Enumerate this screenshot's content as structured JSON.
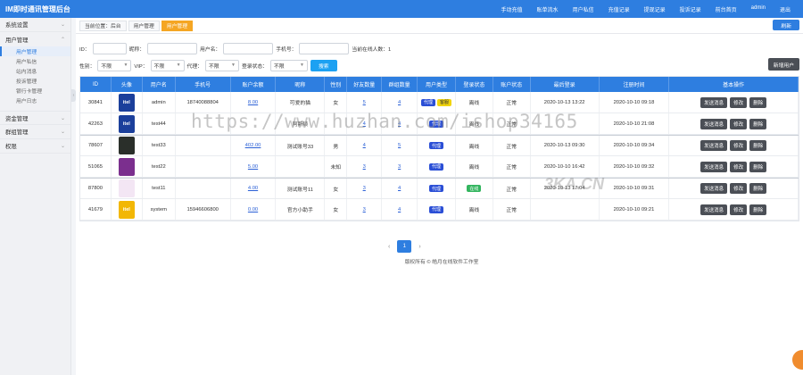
{
  "header": {
    "app_title": "IM即时通讯管理后台",
    "nav": [
      "手动充值",
      "账单流水",
      "用户私信",
      "充值记录",
      "提现记录",
      "投诉记录",
      "前台首页",
      "admin",
      "退出"
    ]
  },
  "sidebar": {
    "groups": [
      {
        "label": "系统设置",
        "items": []
      },
      {
        "label": "用户管理",
        "items": [
          "用户管理",
          "用户私信",
          "站内消息",
          "投诉管理",
          "银行卡管理",
          "用户日志"
        ]
      },
      {
        "label": "资金管理",
        "items": []
      },
      {
        "label": "群组管理",
        "items": []
      },
      {
        "label": "权限",
        "items": []
      }
    ],
    "active_item": "用户管理"
  },
  "tabs": {
    "crumbs": [
      "当前位置：后台",
      "用户管理",
      "用户管理"
    ],
    "refresh_label": "刷新"
  },
  "filters": {
    "id_label": "ID：",
    "nickname_label": "昵称：",
    "username_label": "用户名：",
    "phone_label": "手机号：",
    "online_stat_label": "当前在线人数：",
    "online_count": "1",
    "gender_label": "性别：",
    "gender_value": "不限",
    "vip_label": "VIP：",
    "vip_value": "不限",
    "agent_label": "代理：",
    "agent_value": "不限",
    "login_status_label": "登录状态：",
    "login_status_value": "不限",
    "search_label": "搜索",
    "add_user_label": "新增用户"
  },
  "table": {
    "columns": [
      "ID",
      "头像",
      "用户名",
      "手机号",
      "账户余额",
      "昵称",
      "性别",
      "好友数量",
      "群组数量",
      "用户类型",
      "登录状态",
      "账户状态",
      "最后登录",
      "注册时间",
      "基本操作"
    ],
    "rows": [
      {
        "id": "30841",
        "avatar": "itel",
        "avatar_color": "#1b3f9b",
        "username": "admin",
        "phone": "18740088804",
        "balance": "8.00",
        "nickname": "可爱的猫",
        "gender": "女",
        "friends": "5",
        "groups": "4",
        "types": [
          {
            "label": "代理",
            "color": "#2b4fd6"
          },
          {
            "label": "客服",
            "color": "#f1d40d"
          }
        ],
        "login_status": "离线",
        "account_status": "正常",
        "last_login": "2020-10-13 13:22",
        "reg_time": "2020-10-10 09:18"
      },
      {
        "id": "42263",
        "avatar": "itel",
        "avatar_color": "#1b3f9b",
        "username": "test44",
        "phone": "",
        "balance": "",
        "nickname": "阿斯顿",
        "gender": "",
        "friends": "4",
        "groups": "4",
        "types": [
          {
            "label": "代理",
            "color": "#2b4fd6"
          }
        ],
        "login_status": "离线",
        "account_status": "正常",
        "last_login": "",
        "reg_time": "2020-10-10 21:08"
      },
      {
        "id": "78607",
        "avatar": "",
        "avatar_color": "#2a2f2a",
        "username": "test33",
        "phone": "",
        "balance": "402.00",
        "nickname": "测试账号33",
        "gender": "男",
        "friends": "4",
        "groups": "5",
        "types": [
          {
            "label": "代理",
            "color": "#2b4fd6"
          }
        ],
        "login_status": "离线",
        "account_status": "正常",
        "last_login": "2020-10-13 09:30",
        "reg_time": "2020-10-10 09:34"
      },
      {
        "id": "51065",
        "avatar": "",
        "avatar_color": "#7b2f8e",
        "username": "test22",
        "phone": "",
        "balance": "5.00",
        "nickname": "",
        "gender": "未知",
        "friends": "3",
        "groups": "3",
        "types": [
          {
            "label": "代理",
            "color": "#2b4fd6"
          }
        ],
        "login_status": "离线",
        "account_status": "正常",
        "last_login": "2020-10-10 16:42",
        "reg_time": "2020-10-10 09:32"
      },
      {
        "id": "87800",
        "avatar": "",
        "avatar_color": "#f3e6f4",
        "username": "test11",
        "phone": "",
        "balance": "4.00",
        "nickname": "测试账号11",
        "gender": "女",
        "friends": "3",
        "groups": "4",
        "types": [
          {
            "label": "代理",
            "color": "#2b4fd6"
          }
        ],
        "login_status": "在线",
        "login_status_color": "#33b55f",
        "account_status": "正常",
        "last_login": "2020-10-13 17:04",
        "reg_time": "2020-10-10 09:31"
      },
      {
        "id": "41679",
        "avatar": "itel",
        "avatar_color": "#f2b705",
        "username": "system",
        "phone": "15946606800",
        "balance": "0.00",
        "nickname": "官方小助手",
        "gender": "女",
        "friends": "3",
        "groups": "4",
        "types": [
          {
            "label": "代理",
            "color": "#2b4fd6"
          }
        ],
        "login_status": "离线",
        "account_status": "正常",
        "last_login": "",
        "reg_time": "2020-10-10 09:21"
      }
    ],
    "actions": [
      "发送消息",
      "修改",
      "删除"
    ]
  },
  "pagination": {
    "prev": "‹",
    "current": "1",
    "next": "›"
  },
  "footer": {
    "copyright": "版权所有 © 皓月在线软件工作室"
  },
  "watermark": {
    "text": "https://www.huzhan.com/ishop34165",
    "logo": "3KA.CN"
  }
}
